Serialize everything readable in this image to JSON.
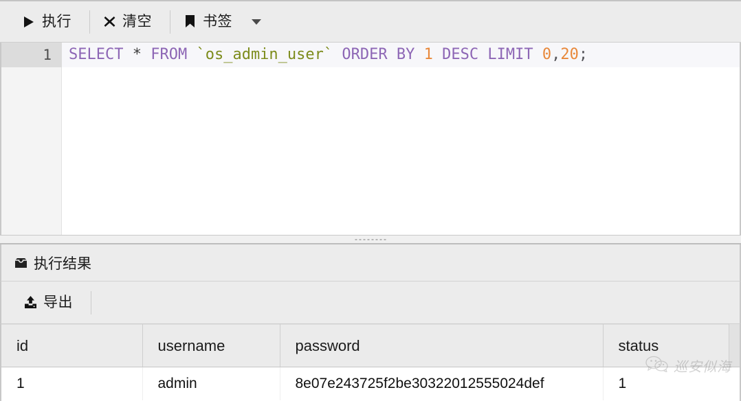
{
  "toolbar": {
    "buttons": [
      {
        "id": "execute",
        "label": "执行",
        "icon": "play-icon"
      },
      {
        "id": "clear",
        "label": "清空",
        "icon": "close-icon"
      },
      {
        "id": "bookmark",
        "label": "书签",
        "icon": "bookmark-icon"
      }
    ],
    "dropdown_icon": "chevron-down-icon"
  },
  "editor": {
    "line_number": "1",
    "sql_text": "SELECT * FROM `os_admin_user` ORDER BY 1 DESC LIMIT 0,20;",
    "tokens": [
      {
        "t": "SELECT",
        "k": "kw"
      },
      {
        "t": " ",
        "k": "op"
      },
      {
        "t": "*",
        "k": "op"
      },
      {
        "t": " ",
        "k": "op"
      },
      {
        "t": "FROM",
        "k": "kw"
      },
      {
        "t": " ",
        "k": "op"
      },
      {
        "t": "`os_admin_user`",
        "k": "ident"
      },
      {
        "t": " ",
        "k": "op"
      },
      {
        "t": "ORDER",
        "k": "kw"
      },
      {
        "t": " ",
        "k": "op"
      },
      {
        "t": "BY",
        "k": "kw"
      },
      {
        "t": " ",
        "k": "op"
      },
      {
        "t": "1",
        "k": "num"
      },
      {
        "t": " ",
        "k": "op"
      },
      {
        "t": "DESC",
        "k": "kw"
      },
      {
        "t": " ",
        "k": "op"
      },
      {
        "t": "LIMIT",
        "k": "kw"
      },
      {
        "t": " ",
        "k": "op"
      },
      {
        "t": "0",
        "k": "num"
      },
      {
        "t": ",",
        "k": "punc"
      },
      {
        "t": "20",
        "k": "num"
      },
      {
        "t": ";",
        "k": "punc"
      }
    ]
  },
  "result_panel": {
    "title": "执行结果",
    "title_icon": "inbox-icon",
    "export_label": "导出",
    "export_icon": "upload-icon"
  },
  "table": {
    "columns": [
      "id",
      "username",
      "password",
      "status"
    ],
    "rows": [
      [
        "1",
        "admin",
        "8e07e243725f2be30322012555024def",
        "1"
      ]
    ]
  },
  "watermark": {
    "text": "巡安似海",
    "icon": "wechat-icon"
  },
  "colors": {
    "keyword": "#8d66b5",
    "identifier": "#7d8c1c",
    "number": "#e8883a",
    "toolbar_bg": "#ececec",
    "editor_bg": "#ffffff",
    "header_bg": "#ebebeb"
  }
}
